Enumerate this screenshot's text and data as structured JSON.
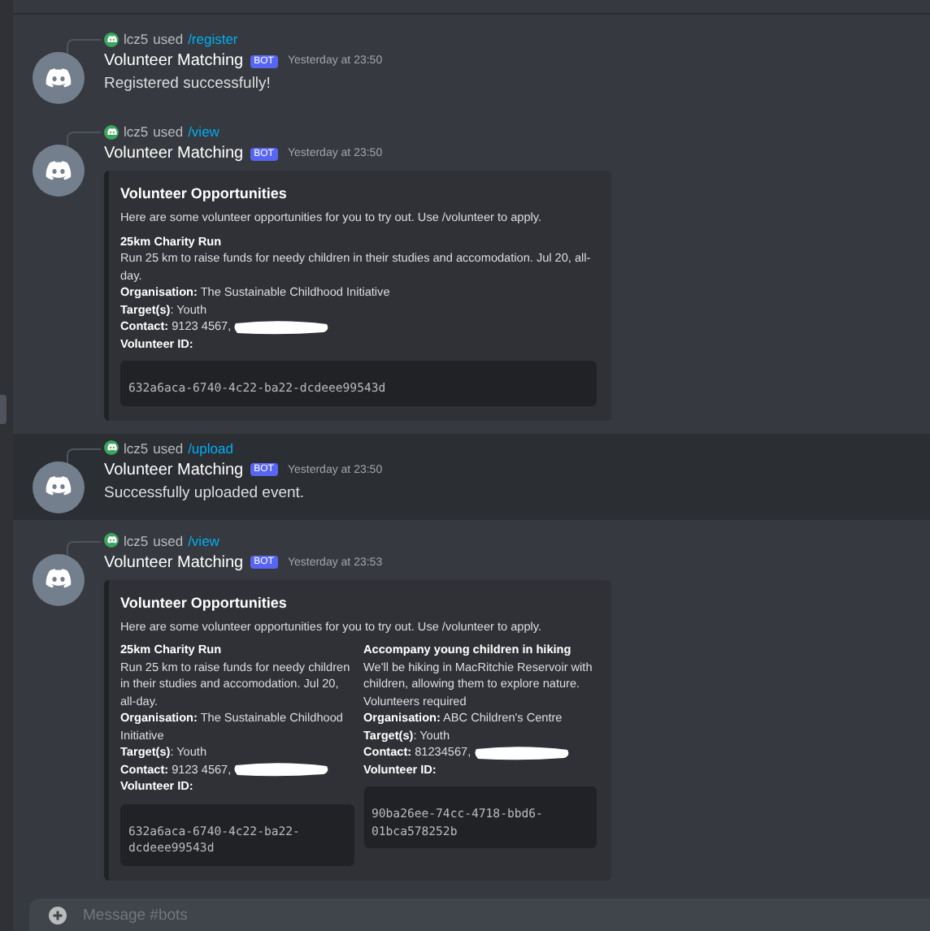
{
  "messages": [
    {
      "user": "lcz5",
      "used": "used",
      "command": "/register",
      "author": "Volunteer Matching",
      "badge": "BOT",
      "time": "Yesterday at 23:50",
      "highlighted": false,
      "text": "Registered successfully!"
    },
    {
      "user": "lcz5",
      "used": "used",
      "command": "/view",
      "author": "Volunteer Matching",
      "badge": "BOT",
      "time": "Yesterday at 23:50",
      "highlighted": false,
      "embed": {
        "title": "Volunteer Opportunities",
        "description": "Here are some volunteer opportunities for you to try out. Use /volunteer to apply.",
        "events": [
          {
            "title": "25km Charity Run",
            "description": "Run 25 km to raise funds for needy children in their studies and accomodation. Jul 20, all-day.",
            "fields": [
              "**Organisation:** The Sustainable Childhood Initiative",
              "**Target(s)**: Youth"
            ],
            "contact": "**Contact:** 9123 4567,",
            "redacted": true,
            "id_label": "Volunteer ID:",
            "id": "632a6aca-6740-4c22-ba22-dcdeee99543d"
          }
        ]
      }
    },
    {
      "user": "lcz5",
      "used": "used",
      "command": "/upload",
      "author": "Volunteer Matching",
      "badge": "BOT",
      "time": "Yesterday at 23:50",
      "highlighted": true,
      "text": "Successfully uploaded event."
    },
    {
      "user": "lcz5",
      "used": "used",
      "command": "/view",
      "author": "Volunteer Matching",
      "badge": "BOT",
      "time": "Yesterday at 23:53",
      "highlighted": false,
      "embed": {
        "title": "Volunteer Opportunities",
        "description": "Here are some volunteer opportunities for you to try out. Use /volunteer to apply.",
        "events": [
          {
            "title": "25km Charity Run",
            "description": "Run 25 km to raise funds for needy children in their studies and accomodation. Jul 20, all-day.",
            "fields": [
              "**Organisation:** The Sustainable Childhood Initiative",
              "**Target(s)**: Youth"
            ],
            "contact": "**Contact:** 9123 4567,",
            "redacted": true,
            "id_label": "Volunteer ID:",
            "id": "632a6aca-6740-4c22-ba22-dcdeee99543d"
          },
          {
            "title": "Accompany young children in hiking",
            "description": "We'll be hiking in MacRitchie Reservoir with children, allowing them to explore nature. Volunteers required",
            "fields": [
              "**Organisation:** ABC Children's Centre",
              "**Target(s)**: Youth"
            ],
            "contact": "**Contact:** 81234567,",
            "redacted": true,
            "id_label": "Volunteer ID:",
            "id": "90ba26ee-74cc-4718-bbd6-01bca578252b"
          }
        ]
      }
    }
  ],
  "composer": {
    "placeholder": "Message #bots"
  }
}
